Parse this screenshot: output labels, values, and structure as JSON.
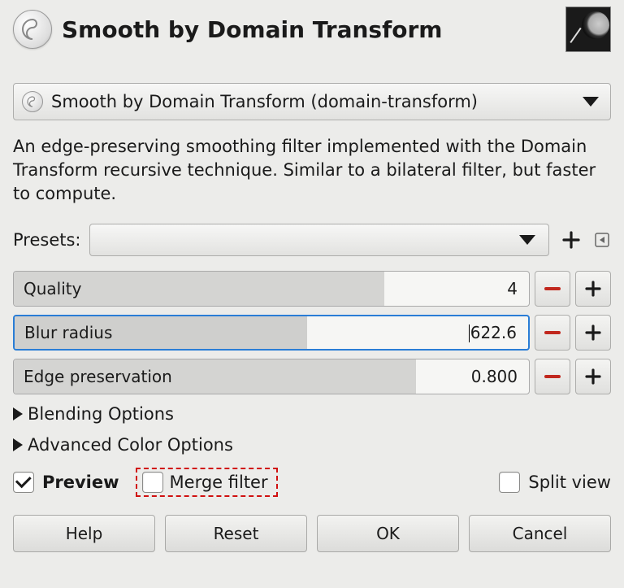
{
  "header": {
    "title": "Smooth by Domain Transform"
  },
  "operation_selector": {
    "label": "Smooth by Domain Transform (domain-transform)"
  },
  "description": "An edge-preserving smoothing filter implemented with the Domain Transform recursive technique. Similar to a bilateral filter, but faster to compute.",
  "presets": {
    "label": "Presets:"
  },
  "params": [
    {
      "label": "Quality",
      "value": "4",
      "fill_percent": 72,
      "focused": false
    },
    {
      "label": "Blur radius",
      "value": "622.6",
      "fill_percent": 57,
      "focused": true
    },
    {
      "label": "Edge preservation",
      "value": "0.800",
      "fill_percent": 78,
      "focused": false
    }
  ],
  "expanders": {
    "blending": "Blending Options",
    "advcolor": "Advanced Color Options"
  },
  "checks": {
    "preview_label": "Preview",
    "preview_checked": true,
    "merge_label": "Merge filter",
    "merge_checked": false,
    "split_label": "Split view",
    "split_checked": false
  },
  "buttons": {
    "help": "Help",
    "reset": "Reset",
    "ok": "OK",
    "cancel": "Cancel"
  }
}
